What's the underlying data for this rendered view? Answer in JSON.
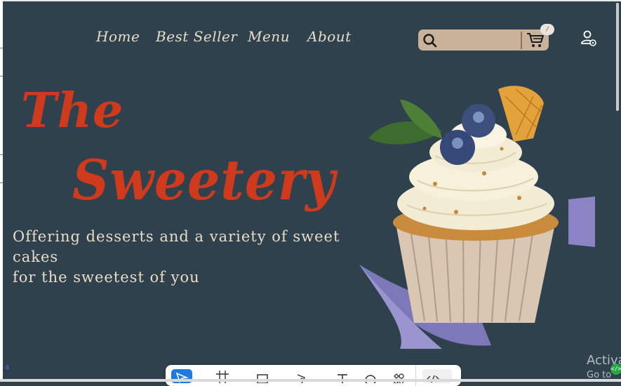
{
  "nav": {
    "items": [
      {
        "label": "Home"
      },
      {
        "label": "Best Seller"
      },
      {
        "label": "Menu"
      },
      {
        "label": "About"
      }
    ]
  },
  "search": {
    "placeholder": "",
    "icon": "search-icon"
  },
  "cart": {
    "icon": "cart-icon",
    "badge": "/"
  },
  "account": {
    "icon": "user-settings-icon"
  },
  "hero": {
    "title_line1": "The",
    "title_line2": "Sweetery",
    "tagline_line1": "Offering desserts and a variety of sweet cakes",
    "tagline_line2": "for the sweetest of you",
    "image": "cupcake-illustration"
  },
  "page_indicator": "4",
  "toolbar": {
    "tools": [
      {
        "name": "move-tool-icon"
      },
      {
        "name": "frame-tool-icon"
      },
      {
        "name": "rectangle-tool-icon"
      },
      {
        "name": "pen-tool-icon"
      },
      {
        "name": "text-tool-icon"
      },
      {
        "name": "comment-tool-icon"
      },
      {
        "name": "components-tool-icon"
      },
      {
        "name": "dev-mode-icon"
      }
    ],
    "caret": "⌄"
  },
  "watermark": {
    "line1": "Activa",
    "line2": "Go to"
  },
  "colors": {
    "background": "#2f414c",
    "accent": "#cf3a1d",
    "text_cream": "#e8dcc6",
    "search_bg": "#c9b29a",
    "tool_active": "#1f7ae0"
  }
}
